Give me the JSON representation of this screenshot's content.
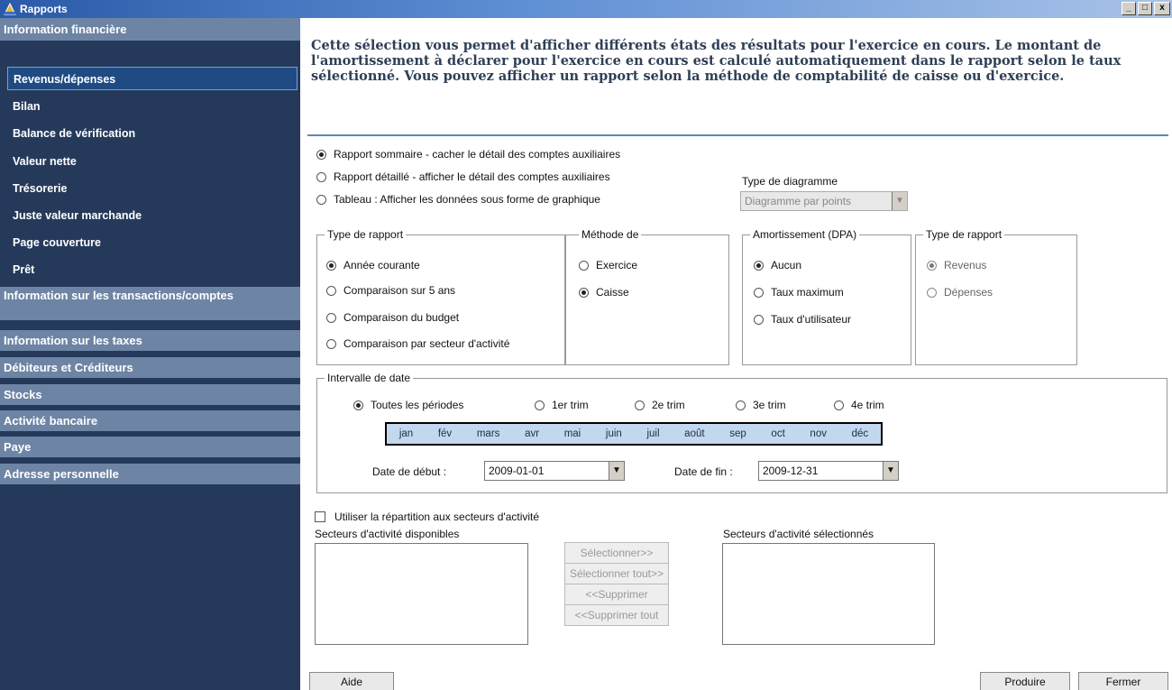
{
  "window": {
    "title": "Rapports",
    "minimize": "_",
    "maximize": "□",
    "close": "x"
  },
  "sidebar": {
    "category1": "Information financière",
    "items": [
      "Revenus/dépenses",
      "Bilan",
      "Balance de vérification",
      "Valeur nette",
      "Trésorerie",
      "Juste valeur marchande",
      "Page couverture",
      "Prêt"
    ],
    "categories": [
      "Information sur les transactions/comptes",
      "Information sur les taxes",
      "Débiteurs et Créditeurs",
      "Stocks",
      "Activité bancaire",
      "Paye",
      "Adresse personnelle"
    ]
  },
  "main": {
    "description": "Cette sélection vous permet d'afficher différents états des résultats pour l'exercice en cours. Le montant de l'amortissement à déclarer pour l'exercice en cours est calculé automatiquement dans le rapport selon le taux sélectionné. Vous pouvez afficher un rapport selon la méthode de comptabilité de caisse ou d'exercice.",
    "report_modes": [
      "Rapport sommaire - cacher le détail des comptes auxiliaires",
      "Rapport détaillé - afficher le détail des comptes auxiliaires",
      "Tableau : Afficher les données sous forme de graphique"
    ],
    "chart_type_label": "Type de diagramme",
    "chart_type_value": "Diagramme par points",
    "group_report_type": {
      "legend": "Type de rapport",
      "options": [
        "Année courante",
        "Comparaison sur 5 ans",
        "Comparaison du budget",
        "Comparaison par secteur d'activité"
      ]
    },
    "group_method": {
      "legend": "Méthode de",
      "options": [
        "Exercice",
        "Caisse"
      ]
    },
    "group_amort": {
      "legend": "Amortissement (DPA)",
      "options": [
        "Aucun",
        "Taux maximum",
        "Taux d'utilisateur"
      ]
    },
    "group_report_type2": {
      "legend": "Type de rapport",
      "options": [
        "Revenus",
        "Dépenses"
      ]
    },
    "date_interval": {
      "legend": "Intervalle de date",
      "periods": [
        "Toutes les périodes",
        "1er trim",
        "2e trim",
        "3e trim",
        "4e trim"
      ],
      "months": [
        "jan",
        "fév",
        "mars",
        "avr",
        "mai",
        "juin",
        "juil",
        "août",
        "sep",
        "oct",
        "nov",
        "déc"
      ],
      "start_label": "Date de début :",
      "start_value": "2009-01-01",
      "end_label": "Date de fin :",
      "end_value": "2009-12-31"
    },
    "use_sectors_label": "Utiliser la répartition aux secteurs d'activité",
    "available_sectors_label": "Secteurs d'activité disponibles",
    "selected_sectors_label": "Secteurs d'activité sélectionnés",
    "buttons": {
      "select": "Sélectionner>>",
      "select_all": "Sélectionner tout>>",
      "remove": "<<Supprimer",
      "remove_all": "<<Supprimer tout",
      "help": "Aide",
      "produce": "Produire",
      "close": "Fermer"
    }
  }
}
